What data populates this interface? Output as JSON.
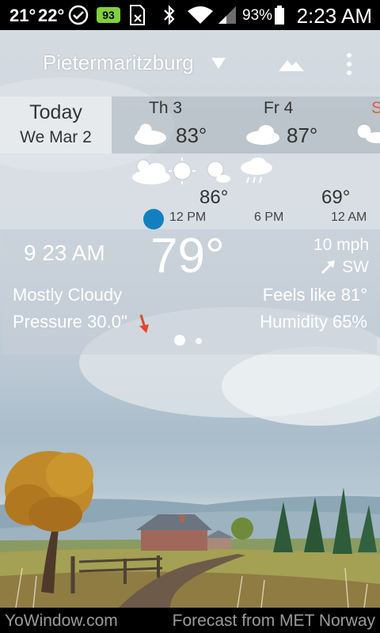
{
  "status_bar": {
    "temp_1": "21°",
    "temp_2": "22°",
    "badge": "93",
    "battery_pct": "93%",
    "time": "2:23 AM"
  },
  "header": {
    "city": "Pietermaritzburg"
  },
  "days": {
    "today_label": "Today",
    "today_date": "We Mar 2",
    "items": [
      {
        "name": "Th 3",
        "temp": "83°"
      },
      {
        "name": "Fr 4",
        "temp": "87°"
      },
      {
        "name": "S",
        "temp": ""
      }
    ]
  },
  "hourly": {
    "temps": [
      "86°",
      "69°"
    ],
    "times": [
      "12 PM",
      "6 PM",
      "12 AM"
    ]
  },
  "current": {
    "time": "9  23 AM",
    "temp": "79°",
    "wind_speed": "10 mph",
    "wind_dir": "SW",
    "condition": "Mostly Cloudy",
    "pressure": "Pressure 30.0\"",
    "feels_like": "Feels like 81°",
    "humidity": "Humidity 65%"
  },
  "footer": {
    "left": "YoWindow.com",
    "right": "Forecast from MET Norway"
  },
  "colors": {
    "accent_blue": "#1280c0",
    "pressure_arrow": "#e0482a",
    "weekend_red": "#e05a40"
  }
}
